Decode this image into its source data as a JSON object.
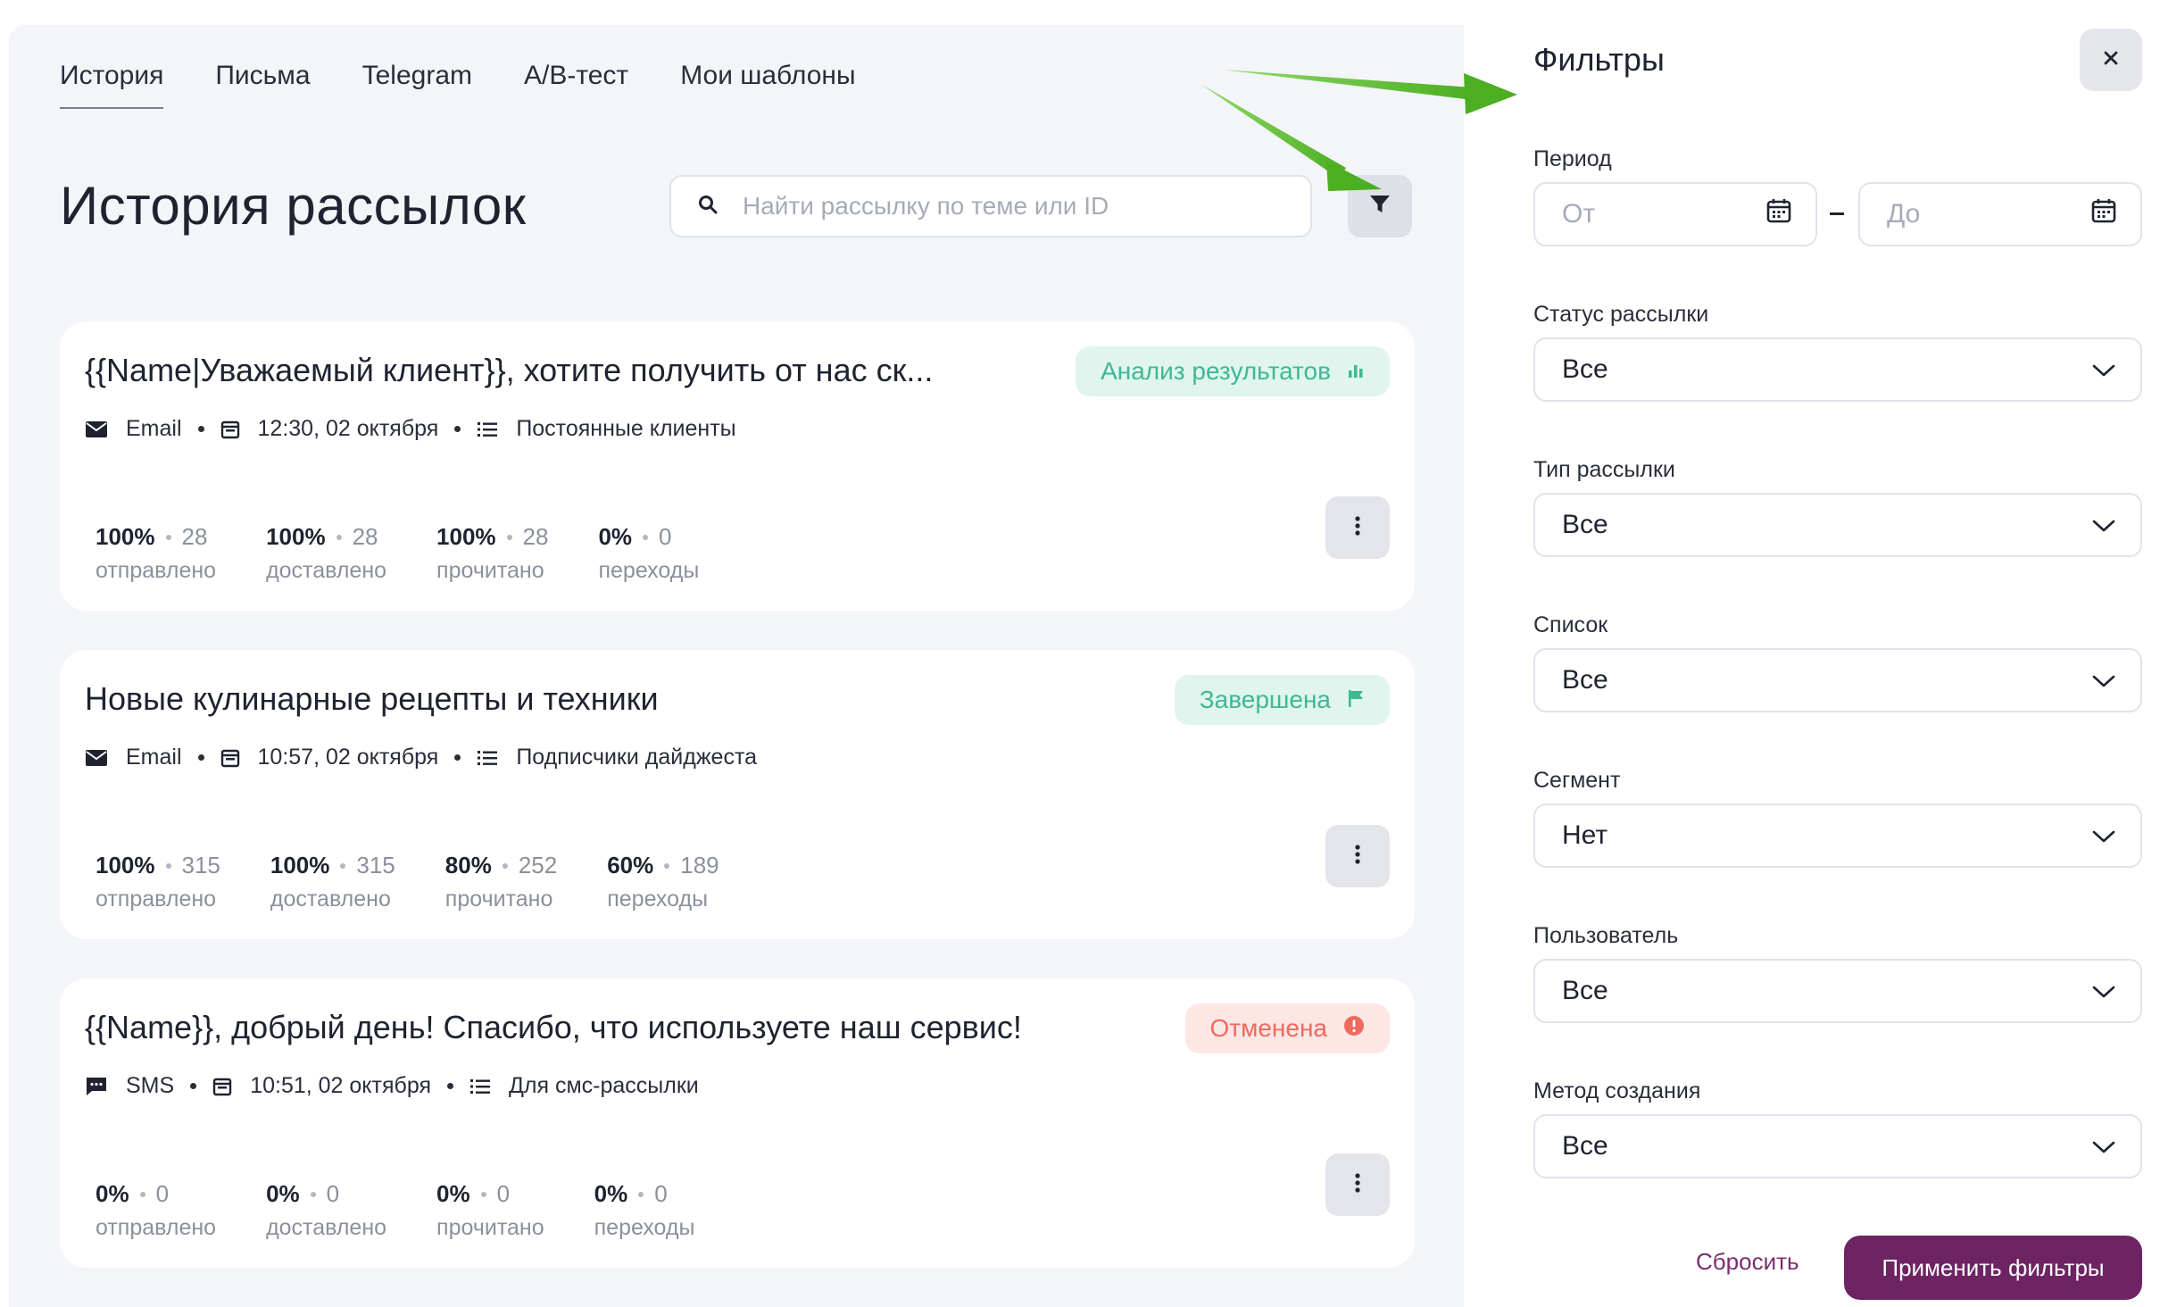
{
  "tabs": [
    {
      "label": "История"
    },
    {
      "label": "Письма"
    },
    {
      "label": "Telegram"
    },
    {
      "label": "A/B-тест"
    },
    {
      "label": "Мои шаблоны"
    }
  ],
  "page_title": "История рассылок",
  "search": {
    "placeholder": "Найти рассылку по теме или ID",
    "value": ""
  },
  "campaigns": [
    {
      "title": "{{Name|Уважаемый клиент}}, хотите получить от нас ск...",
      "status": "Анализ результатов",
      "channel": "Email",
      "datetime": "12:30, 02 октября",
      "list": "Постоянные клиенты",
      "stats": [
        {
          "pct": "100%",
          "count": "28",
          "label": "отправлено"
        },
        {
          "pct": "100%",
          "count": "28",
          "label": "доставлено"
        },
        {
          "pct": "100%",
          "count": "28",
          "label": "прочитано"
        },
        {
          "pct": "0%",
          "count": "0",
          "label": "переходы"
        }
      ]
    },
    {
      "title": "Новые кулинарные рецепты и техники",
      "status": "Завершена",
      "channel": "Email",
      "datetime": "10:57, 02 октября",
      "list": "Подписчики дайджеста",
      "stats": [
        {
          "pct": "100%",
          "count": "315",
          "label": "отправлено"
        },
        {
          "pct": "100%",
          "count": "315",
          "label": "доставлено"
        },
        {
          "pct": "80%",
          "count": "252",
          "label": "прочитано"
        },
        {
          "pct": "60%",
          "count": "189",
          "label": "переходы"
        }
      ]
    },
    {
      "title": "{{Name}}, добрый день! Спасибо, что используете наш сервис!",
      "status": "Отменена",
      "channel": "SMS",
      "datetime": "10:51, 02 октября",
      "list": "Для смс-рассылки",
      "stats": [
        {
          "pct": "0%",
          "count": "0",
          "label": "отправлено"
        },
        {
          "pct": "0%",
          "count": "0",
          "label": "доставлено"
        },
        {
          "pct": "0%",
          "count": "0",
          "label": "прочитано"
        },
        {
          "pct": "0%",
          "count": "0",
          "label": "переходы"
        }
      ]
    }
  ],
  "filters": {
    "title": "Фильтры",
    "period_label": "Период",
    "from_placeholder": "От",
    "to_placeholder": "До",
    "status_label": "Статус рассылки",
    "status_value": "Все",
    "type_label": "Тип рассылки",
    "type_value": "Все",
    "list_label": "Список",
    "list_value": "Все",
    "segment_label": "Сегмент",
    "segment_value": "Нет",
    "user_label": "Пользователь",
    "user_value": "Все",
    "method_label": "Метод создания",
    "method_value": "Все",
    "reset_label": "Сбросить",
    "apply_label": "Применить фильтры"
  },
  "colors": {
    "accent": "#6e2463",
    "status_green": "#3fb894",
    "status_red": "#ee6a5e",
    "annotation_arrow": "#5cbf2a"
  }
}
